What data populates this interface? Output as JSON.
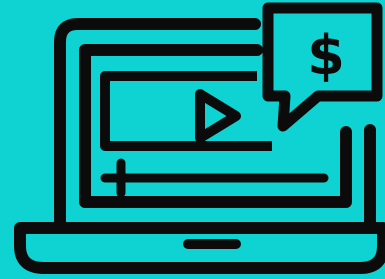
{
  "illustration": {
    "background_color": "#0fd3d3",
    "stroke_color": "#0b0b0b",
    "icon": "laptop-video-monetization-icon",
    "price_symbol": "$",
    "parts": [
      "laptop-screen-icon",
      "play-icon",
      "video-progress-bar-icon",
      "price-speech-bubble-icon",
      "laptop-base-icon"
    ]
  }
}
